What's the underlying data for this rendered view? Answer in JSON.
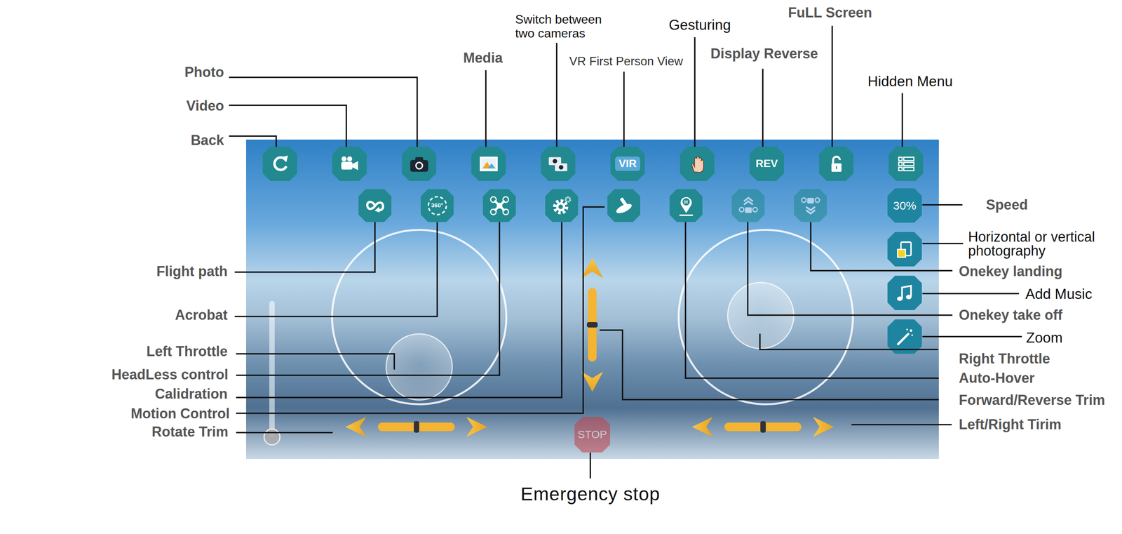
{
  "callouts": [
    {
      "text": "Photo"
    },
    {
      "text": "Video"
    },
    {
      "text": "Back"
    },
    {
      "text": "Media"
    },
    {
      "text": "Switch between two cameras"
    },
    {
      "text": "VR First Person View"
    },
    {
      "text": "Gesturing"
    },
    {
      "text": "Display Reverse"
    },
    {
      "text": "FuLL Screen"
    },
    {
      "text": "Hidden Menu"
    },
    {
      "text": "Speed"
    },
    {
      "text": "Horizontal or vertical photography"
    },
    {
      "text": "Onekey landing"
    },
    {
      "text": "Add Music"
    },
    {
      "text": "Onekey take off"
    },
    {
      "text": "Zoom"
    },
    {
      "text": "Right Throttle"
    },
    {
      "text": "Auto-Hover"
    },
    {
      "text": "Forward/Reverse Trim"
    },
    {
      "text": "Left/Right Tirim"
    },
    {
      "text": "Flight path"
    },
    {
      "text": "Acrobat"
    },
    {
      "text": "Left Throttle"
    },
    {
      "text": "HeadLess control"
    },
    {
      "text": "Calidration"
    },
    {
      "text": "Motion Control"
    },
    {
      "text": "Rotate Trim"
    },
    {
      "text": "Emergency stop"
    }
  ],
  "control_panel": {
    "vr_label": "VIR",
    "reverse_label": "REV",
    "acrobat_label": "360°",
    "auto_hover_label": "H",
    "speed": "30%",
    "stop_label": "STOP",
    "stop_disabled": true,
    "second_row": [
      {
        "disabled": false
      },
      {
        "disabled": false
      },
      {
        "disabled": false
      },
      {
        "disabled": false
      },
      {
        "disabled": false
      },
      {
        "disabled": false
      },
      {
        "disabled": true
      },
      {
        "disabled": true
      }
    ],
    "throttle": {
      "level": 0
    },
    "sticks": [
      {
        "x": 0.5,
        "y": 0.21
      },
      {
        "x": 0.47,
        "y": 0.51
      }
    ],
    "trims": {
      "forward_reverse": 0.5,
      "rotate": 0.5,
      "left_right": 0.5
    }
  }
}
